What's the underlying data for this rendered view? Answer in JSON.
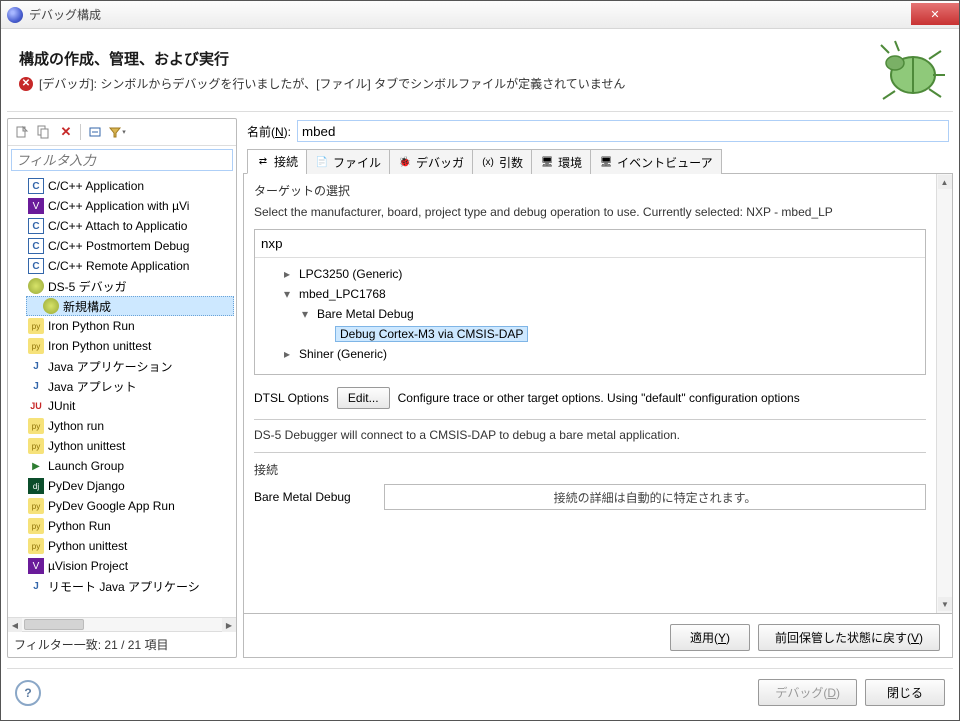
{
  "title": "デバッグ構成",
  "header": {
    "heading": "構成の作成、管理、および実行",
    "err": "[デバッガ]: シンボルからデバッグを行いましたが、[ファイル] タブでシンボルファイルが定義されていません"
  },
  "left": {
    "filter_placeholder": "フィルタ入力",
    "items": [
      {
        "label": "C/C++ Application",
        "ic": "box",
        "txt": "C"
      },
      {
        "label": "C/C++ Application with µVi",
        "ic": "pur",
        "txt": "V"
      },
      {
        "label": "C/C++ Attach to Applicatio",
        "ic": "box",
        "txt": "C"
      },
      {
        "label": "C/C++ Postmortem Debug",
        "ic": "box",
        "txt": "C"
      },
      {
        "label": "C/C++ Remote Application",
        "ic": "box",
        "txt": "C"
      },
      {
        "label": "DS-5 デバッガ",
        "ic": "bee",
        "txt": "",
        "expanded": true,
        "children": [
          {
            "label": "新規構成",
            "ic": "bee",
            "txt": "",
            "selected": true
          }
        ]
      },
      {
        "label": "Iron Python Run",
        "ic": "py",
        "txt": "py"
      },
      {
        "label": "Iron Python unittest",
        "ic": "py",
        "txt": "py"
      },
      {
        "label": "Java アプリケーション",
        "ic": "jav",
        "txt": "J"
      },
      {
        "label": "Java アプレット",
        "ic": "jav",
        "txt": "J"
      },
      {
        "label": "JUnit",
        "ic": "jun",
        "txt": "JU"
      },
      {
        "label": "Jython run",
        "ic": "py",
        "txt": "py"
      },
      {
        "label": "Jython unittest",
        "ic": "py",
        "txt": "py"
      },
      {
        "label": "Launch Group",
        "ic": "play",
        "txt": "▶"
      },
      {
        "label": "PyDev Django",
        "ic": "dj",
        "txt": "dj"
      },
      {
        "label": "PyDev Google App Run",
        "ic": "py",
        "txt": "py"
      },
      {
        "label": "Python Run",
        "ic": "py",
        "txt": "py"
      },
      {
        "label": "Python unittest",
        "ic": "py",
        "txt": "py"
      },
      {
        "label": "µVision Project",
        "ic": "pur",
        "txt": "V"
      },
      {
        "label": "リモート Java アプリケーシ",
        "ic": "jav",
        "txt": "J"
      }
    ],
    "count": "フィルター一致: 21 / 21 項目"
  },
  "right": {
    "name_label": "名前(N):",
    "name_value": "mbed",
    "tabs": [
      "接続",
      "ファイル",
      "デバッガ",
      "引数",
      "環境",
      "イベントビューア"
    ],
    "active_tab": 0,
    "target": {
      "title": "ターゲットの選択",
      "desc": "Select the manufacturer, board, project type and debug operation to use. Currently selected: NXP - mbed_LP",
      "filter": "nxp",
      "tree": [
        {
          "label": "LPC3250 (Generic)",
          "lvl": 1,
          "exp": false
        },
        {
          "label": "mbed_LPC1768",
          "lvl": 1,
          "exp": true
        },
        {
          "label": "Bare Metal Debug",
          "lvl": 2,
          "exp": true
        },
        {
          "label": "Debug Cortex-M3 via CMSIS-DAP",
          "lvl": 3,
          "sel": true
        },
        {
          "label": "Shiner (Generic)",
          "lvl": 1,
          "exp": false
        }
      ]
    },
    "dtsl_label": "DTSL Options",
    "dtsl_btn": "Edit...",
    "dtsl_desc": "Configure trace or other target options. Using \"default\" configuration options",
    "note": "DS-5 Debugger will connect to a CMSIS-DAP to debug a bare metal application.",
    "conn_title": "接続",
    "conn_label": "Bare Metal Debug",
    "conn_box": "接続の詳細は自動的に特定されます。",
    "apply": "適用(Y)",
    "revert": "前回保管した状態に戻す(V)"
  },
  "bottom": {
    "debug": "デバッグ(D)",
    "close": "閉じる"
  }
}
